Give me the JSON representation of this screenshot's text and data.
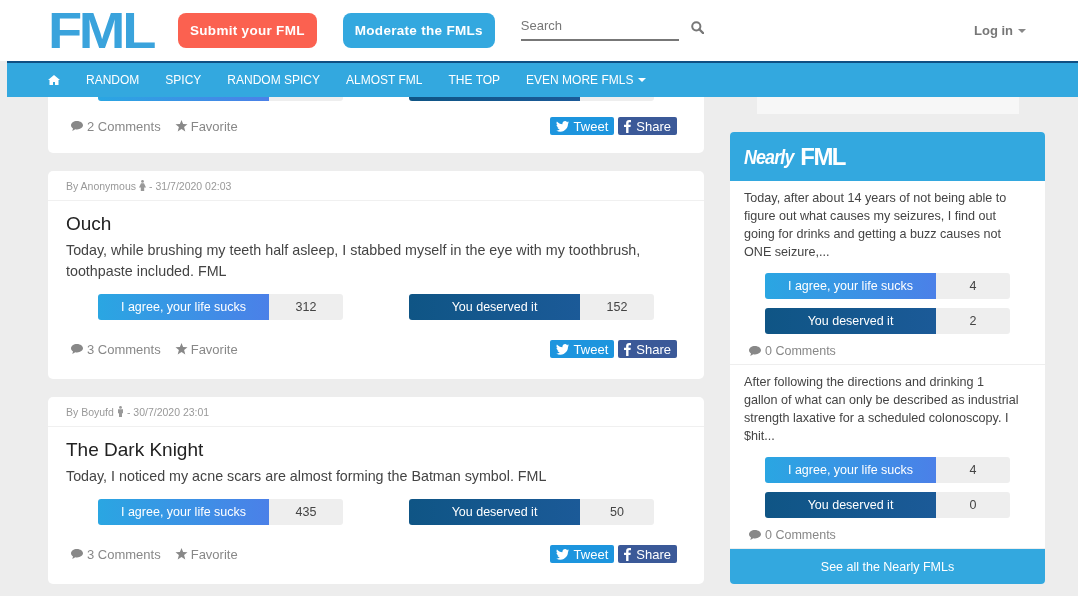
{
  "header": {
    "logo": "FML",
    "submit_button": "Submit your FML",
    "moderate_button": "Moderate the FMLs",
    "search": {
      "placeholder": "Search"
    },
    "login": "Log in"
  },
  "nav": {
    "items": [
      {
        "kind": "home"
      },
      {
        "kind": "link",
        "label": "RANDOM"
      },
      {
        "kind": "link",
        "label": "SPICY"
      },
      {
        "kind": "link",
        "label": "RANDOM SPICY"
      },
      {
        "kind": "link",
        "label": "ALMOST FML"
      },
      {
        "kind": "link",
        "label": "THE TOP"
      },
      {
        "kind": "dropdown",
        "label": "EVEN MORE FMLS"
      }
    ]
  },
  "partial_post": {
    "comments": "2 Comments",
    "favorite": "Favorite",
    "tweet": "Tweet",
    "share": "Share"
  },
  "posts": [
    {
      "author": "By Anonymous",
      "female": true,
      "date": "- 31/7/2020 02:03",
      "title": "Ouch",
      "text": "Today, while brushing my teeth half asleep, I stabbed myself in the eye with my toothbrush, toothpaste included. FML",
      "agree_label": "I agree, your life sucks",
      "agree_count": "312",
      "deserved_label": "You deserved it",
      "deserved_count": "152",
      "comments": "3 Comments",
      "favorite": "Favorite",
      "tweet": "Tweet",
      "share": "Share"
    },
    {
      "author": "By Boyufd",
      "female": false,
      "date": "- 30/7/2020 23:01",
      "title": "The Dark Knight",
      "text": "Today, I noticed my acne scars are almost forming the Batman symbol. FML",
      "agree_label": "I agree, your life sucks",
      "agree_count": "435",
      "deserved_label": "You deserved it",
      "deserved_count": "50",
      "comments": "3 Comments",
      "favorite": "Favorite",
      "tweet": "Tweet",
      "share": "Share"
    }
  ],
  "nearly": {
    "title_prefix": "Nearly",
    "title_logo": "FML",
    "entries": [
      {
        "text": "Today, after about 14 years of not being able to figure out what causes my seizures, I find out going for drinks and getting a buzz causes not ONE seizure,...",
        "agree_label": "I agree, your life sucks",
        "agree_count": "4",
        "deserved_label": "You deserved it",
        "deserved_count": "2",
        "comments": "0 Comments"
      },
      {
        "text": "After following the directions and drinking 1 gallon of what can only be described as industrial strength laxative for a scheduled colonoscopy. I $hit...",
        "agree_label": "I agree, your life sucks",
        "agree_count": "4",
        "deserved_label": "You deserved it",
        "deserved_count": "0",
        "comments": "0 Comments"
      }
    ],
    "see_all": "See all the Nearly FMLs"
  }
}
